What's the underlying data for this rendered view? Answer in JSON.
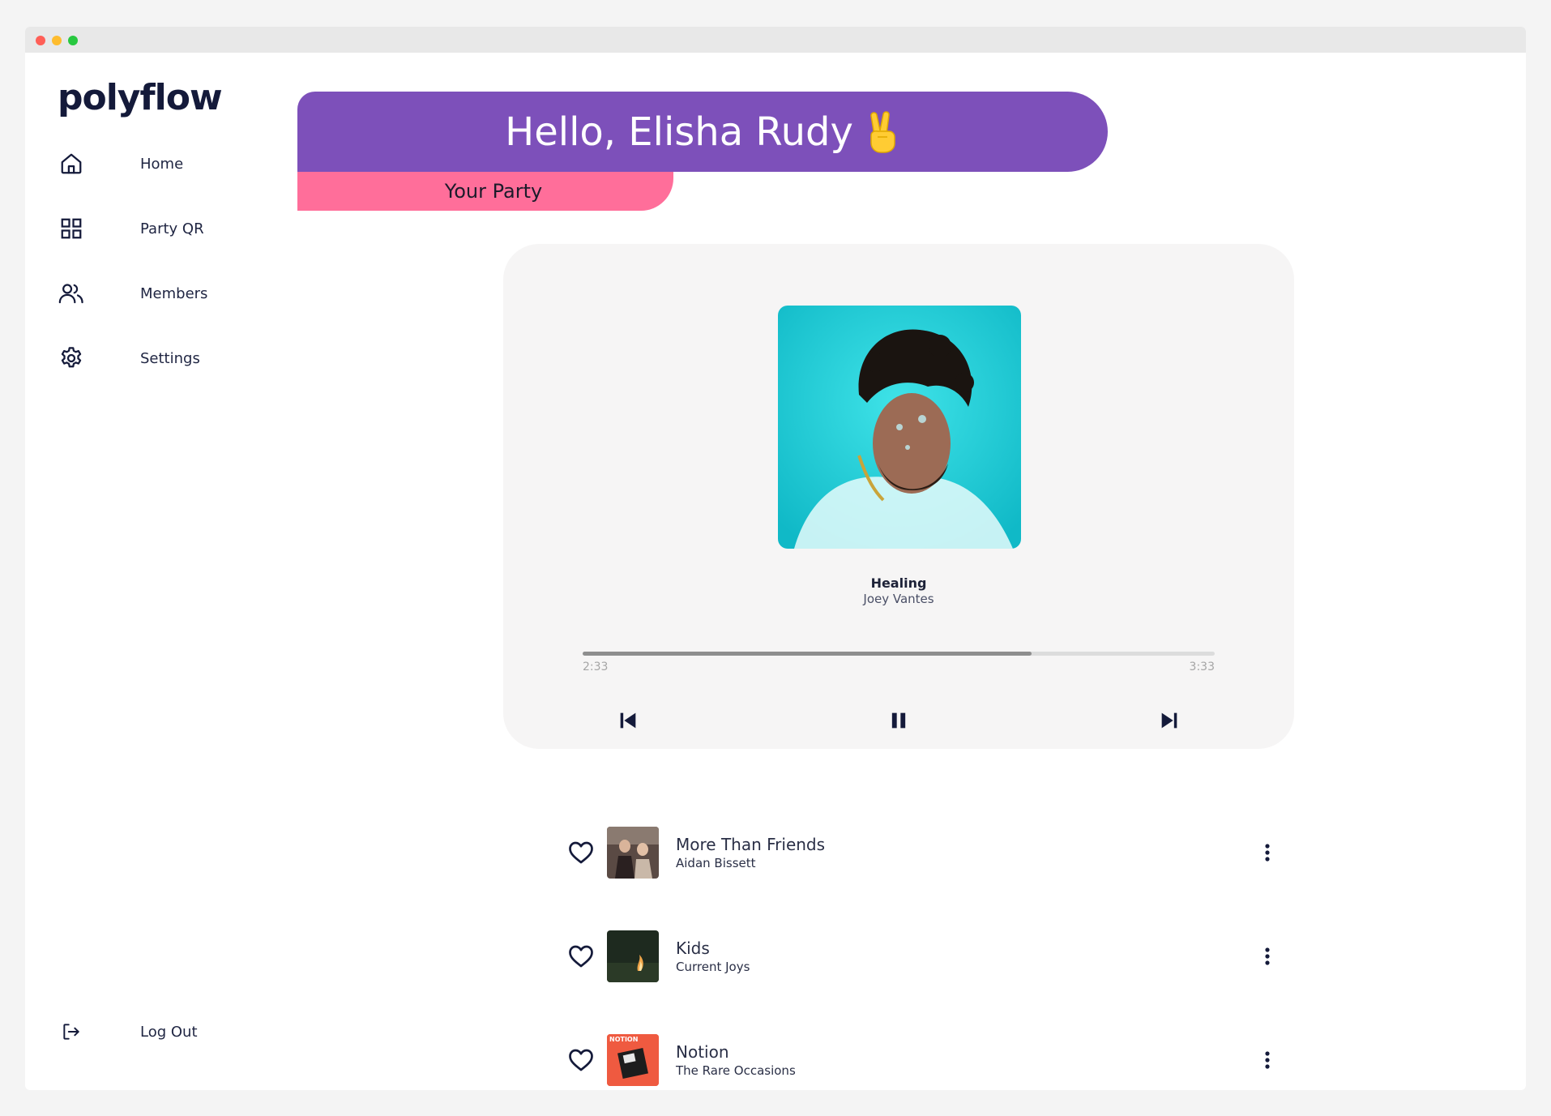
{
  "app": {
    "logo": "polyflow"
  },
  "sidebar": {
    "items": [
      {
        "label": "Home",
        "icon": "home-icon"
      },
      {
        "label": "Party QR",
        "icon": "grid-icon"
      },
      {
        "label": "Members",
        "icon": "users-icon"
      },
      {
        "label": "Settings",
        "icon": "gear-icon"
      }
    ],
    "logout": {
      "label": "Log Out",
      "icon": "logout-icon"
    }
  },
  "header": {
    "greeting": "Hello, Elisha Rudy",
    "emoji": "✌",
    "party_tab": "Your Party"
  },
  "player": {
    "title": "Healing",
    "artist": "Joey Vantes",
    "current_time": "2:33",
    "total_time": "3:33",
    "progress": 0.71,
    "state": "playing"
  },
  "queue": [
    {
      "title": "More Than Friends",
      "artist": "Aidan Bissett"
    },
    {
      "title": "Kids",
      "artist": "Current Joys"
    },
    {
      "title": "Notion",
      "artist": "The Rare Occasions",
      "cover_text": "NOTION"
    }
  ],
  "colors": {
    "accent_purple": "#7d50ba",
    "accent_pink": "#ff6e9a",
    "navy": "#141a3a"
  }
}
